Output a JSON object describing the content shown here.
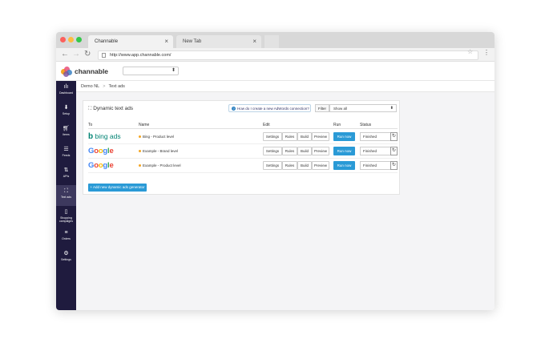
{
  "browser": {
    "tabs": [
      {
        "title": "Channable",
        "active": true
      },
      {
        "title": "New Tab",
        "active": false
      }
    ],
    "url": "http://www.app.channable.com/"
  },
  "app": {
    "logo_text": "channable",
    "project_select": ""
  },
  "sidebar": {
    "items": [
      {
        "label": "Dashboard",
        "icon": "bar-chart-icon"
      },
      {
        "label": "Setup",
        "icon": "download-icon"
      },
      {
        "label": "Items",
        "icon": "cart-icon"
      },
      {
        "label": "Feeds",
        "icon": "sliders-icon"
      },
      {
        "label": "APIs",
        "icon": "arrows-icon"
      },
      {
        "label": "Text ads",
        "icon": "expand-icon",
        "active": true
      },
      {
        "label": "Shopping campaigns",
        "icon": "bag-icon"
      },
      {
        "label": "Orders",
        "icon": "list-icon"
      },
      {
        "label": "Settings",
        "icon": "gear-icon"
      }
    ]
  },
  "breadcrumb": {
    "project": "Demo NL",
    "page": "Text ads"
  },
  "panel": {
    "title": "Dynamic text ads",
    "help_label": "How do I create a new AdWords connection?",
    "filter_label": "Filter",
    "filter_value": "Show all",
    "headers": {
      "to": "To",
      "name": "Name",
      "edit": "Edit",
      "run": "Run",
      "status": "Status"
    },
    "rows": [
      {
        "channel": "bing",
        "name": "Bing - Product level",
        "run": "Run now",
        "status": "Finished"
      },
      {
        "channel": "google",
        "name": "Example - Brand level",
        "run": "Run now",
        "status": "Finished"
      },
      {
        "channel": "google",
        "name": "Example - Product level",
        "run": "Run now",
        "status": "Finished"
      }
    ],
    "edit_buttons": [
      "Settings",
      "Rules",
      "Build",
      "Preview"
    ],
    "add_button": "+ Add new dynamic ads generator"
  },
  "brand_text": {
    "bing_b": "b",
    "bing_word": "bing ads",
    "google": [
      "G",
      "o",
      "o",
      "g",
      "l",
      "e"
    ]
  },
  "colors": {
    "sidebar": "#1f1b3e",
    "accent": "#2a9ad6",
    "bing": "#008373"
  }
}
